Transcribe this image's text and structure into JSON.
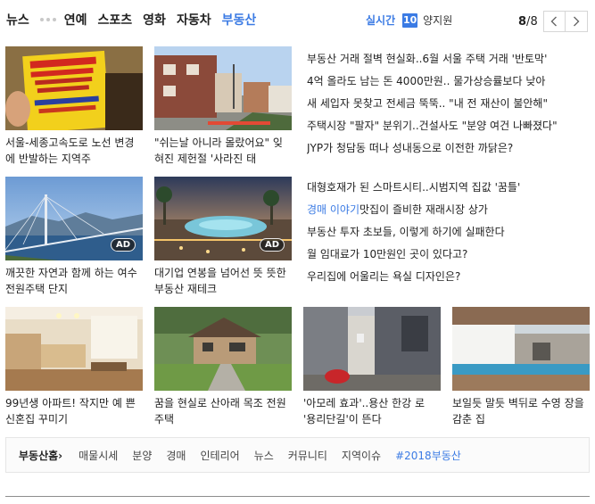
{
  "nav": {
    "tabs": [
      {
        "label": "뉴스"
      },
      {
        "label": "연예"
      },
      {
        "label": "스포츠"
      },
      {
        "label": "영화"
      },
      {
        "label": "자동차"
      },
      {
        "label": "부동산"
      }
    ],
    "active_tab": "부동산",
    "realtime_label": "실시간",
    "realtime_rank": "10",
    "realtime_term": "양지원",
    "page_current": "8",
    "page_sep": "/",
    "page_total": "8"
  },
  "cards": [
    {
      "caption": "서울-세종고속도로 노선 변경에 반발하는 지역주",
      "image": "protest-sign-photo"
    },
    {
      "caption": "\"쉬는날 아니라 몰랐어요\" 잊혀진 제헌절 '사라진 태",
      "image": "hillside-street-photo"
    },
    {
      "caption": "깨끗한 자연과 함께 하는 여수 전원주택 단지",
      "image": "bridge-landscape-photo",
      "ad": "AD"
    },
    {
      "caption": "대기업 연봉을 넘어선 뜻 뜻한 부동산 재테크",
      "image": "resort-pool-photo",
      "ad": "AD"
    },
    {
      "caption": "99년생 아파트! 작지만 예 쁜 신혼집 꾸미기",
      "image": "apartment-interior-photo"
    },
    {
      "caption": "꿈을 현실로 산아래 목조 전원주택",
      "image": "wooden-house-photo"
    },
    {
      "caption": "'아모레 효과'..용산 한강 로 '용리단길'이 뜬다",
      "image": "alley-street-photo"
    },
    {
      "caption": "보일듯 말듯 벽뒤로 수영 장을 감춘 집",
      "image": "modern-pool-house-photo"
    }
  ],
  "headlines_top": [
    {
      "text": "부동산 거래 절벽 현실화..6월 서울 주택 거래 '반토막'"
    },
    {
      "text": "4억 올라도 남는 돈 4000만원.. 물가상승률보다 낮아"
    },
    {
      "text": "새 세입자 못찾고 전세금 뚝뚝.. \"내 전 재산이 불안해\""
    },
    {
      "text": "주택시장 \"팔자\" 분위기..건설사도 \"분양 여건 나빠졌다\""
    },
    {
      "text": "JYP가 청담동 떠나 성내동으로 이전한 까닭은?"
    }
  ],
  "headlines_mid": [
    {
      "text": "대형호재가 된 스마트시티..시범지역 집값 '꿈틀'"
    },
    {
      "accent": "경매 이야기",
      "text": "맛집이 즐비한 재래시장 상가"
    },
    {
      "text": "부동산 투자 초보들, 이렇게 하기에 실패한다"
    },
    {
      "text": "월 임대료가 10만원인 곳이 있다고?"
    },
    {
      "text": "우리집에 어울리는 욕실 디자인은?"
    }
  ],
  "bottom_menu": {
    "home": "부동산홈",
    "home_arrow": "›",
    "items": [
      "매물시세",
      "분양",
      "경매",
      "인테리어",
      "뉴스",
      "커뮤니티",
      "지역이슈"
    ],
    "accent_item": "#2018부동산"
  },
  "colors": {
    "accent": "#3b7be4",
    "text": "#222222",
    "border": "#e6e6e6"
  }
}
